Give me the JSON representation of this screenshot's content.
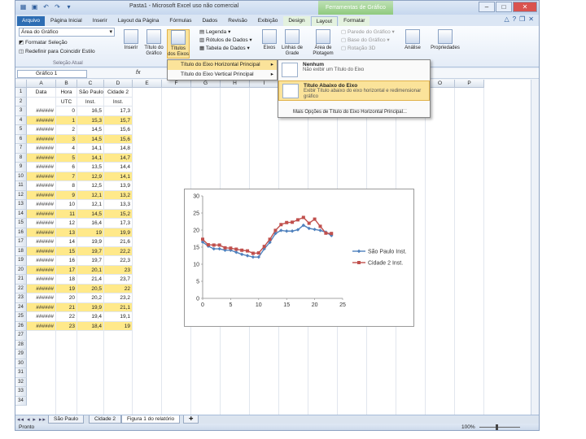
{
  "window": {
    "title": "Pasta1 - Microsoft Excel uso não comercial",
    "context_tab": "Ferramentas de Gráfico"
  },
  "tabs": [
    "Arquivo",
    "Página Inicial",
    "Inserir",
    "Layout da Página",
    "Fórmulas",
    "Dados",
    "Revisão",
    "Exibição",
    "Design",
    "Layout",
    "Formatar"
  ],
  "ribbon": {
    "combo_value": "Área do Gráfico",
    "format_selection": "Formatar Seleção",
    "reset_style": "Redefinir para Coincidir Estilo",
    "group_selection": "Seleção Atual",
    "insert": "Inserir",
    "chart_title": "Título do Gráfico",
    "axis_titles": "Títulos dos Eixos",
    "legend": "Legenda",
    "data_labels": "Rótulos de Dados",
    "data_table": "Tabela de Dados",
    "axes": "Eixos",
    "gridlines": "Linhas de Grade",
    "plot_area": "Área de Plotagem",
    "chart_wall": "Parede do Gráfico",
    "chart_floor": "Base do Gráfico",
    "rotation_3d": "Rotação 3D",
    "analysis": "Análise",
    "properties": "Propriedades"
  },
  "formula_bar": {
    "name_box": "Gráfico 1",
    "fx": "fx"
  },
  "menu1": {
    "items": [
      "Título do Eixo Horizontal Principal",
      "Título do Eixo Vertical Principal"
    ]
  },
  "menu2": {
    "none_title": "Nenhum",
    "none_desc": "Não exibir um Título do Eixo",
    "below_title": "Título Abaixo do Eixo",
    "below_desc": "Exibir Título abaixo do eixo horizontal e redimensionar gráfico",
    "more": "Mais Opções de Título do Eixo Horizontal Principal..."
  },
  "columns": [
    "A",
    "B",
    "C",
    "D",
    "E",
    "F",
    "G",
    "H",
    "I",
    "J",
    "K",
    "L",
    "M",
    "N",
    "O",
    "P"
  ],
  "header_row": {
    "a": "Data",
    "b": "Hora",
    "c": "São Paulo",
    "d": "Cidade 2"
  },
  "header_row2": {
    "b": "UTC",
    "c": "Inst.",
    "d": "Inst."
  },
  "rows": [
    {
      "b": "0",
      "c": "16,5",
      "d": "17,3"
    },
    {
      "b": "1",
      "c": "15,3",
      "d": "15,7"
    },
    {
      "b": "2",
      "c": "14,5",
      "d": "15,6"
    },
    {
      "b": "3",
      "c": "14,5",
      "d": "15,6"
    },
    {
      "b": "4",
      "c": "14,1",
      "d": "14,8"
    },
    {
      "b": "5",
      "c": "14,1",
      "d": "14,7"
    },
    {
      "b": "6",
      "c": "13,5",
      "d": "14,4"
    },
    {
      "b": "7",
      "c": "12,9",
      "d": "14,1"
    },
    {
      "b": "8",
      "c": "12,5",
      "d": "13,9"
    },
    {
      "b": "9",
      "c": "12,1",
      "d": "13,2"
    },
    {
      "b": "10",
      "c": "12,1",
      "d": "13,3"
    },
    {
      "b": "11",
      "c": "14,5",
      "d": "15,2"
    },
    {
      "b": "12",
      "c": "16,4",
      "d": "17,3"
    },
    {
      "b": "13",
      "c": "19",
      "d": "19,9"
    },
    {
      "b": "14",
      "c": "19,9",
      "d": "21,6"
    },
    {
      "b": "15",
      "c": "19,7",
      "d": "22,2"
    },
    {
      "b": "16",
      "c": "19,7",
      "d": "22,3"
    },
    {
      "b": "17",
      "c": "20,1",
      "d": "23"
    },
    {
      "b": "18",
      "c": "21,4",
      "d": "23,7"
    },
    {
      "b": "19",
      "c": "20,5",
      "d": "22"
    },
    {
      "b": "20",
      "c": "20,2",
      "d": "23,2"
    },
    {
      "b": "21",
      "c": "19,9",
      "d": "21,1"
    },
    {
      "b": "22",
      "c": "19,4",
      "d": "19,1"
    },
    {
      "b": "23",
      "c": "18,4",
      "d": "19"
    }
  ],
  "date_placeholder": "######",
  "row_numbers": [
    "1",
    "2",
    "3",
    "4",
    "5",
    "6",
    "7",
    "8",
    "9",
    "10",
    "11",
    "12",
    "13",
    "14",
    "15",
    "16",
    "17",
    "18",
    "19",
    "20",
    "21",
    "22",
    "23",
    "24",
    "25",
    "26",
    "27",
    "28",
    "29",
    "30",
    "31",
    "32",
    "33",
    "34"
  ],
  "sheets": [
    "São Paulo",
    "Cidade 2",
    "Figura 1 do relatório"
  ],
  "status": {
    "left": "Pronto",
    "zoom": "100%"
  },
  "colors": {
    "series1": "#4f81bd",
    "series2": "#c0504d",
    "highlight": "#ffe98a"
  },
  "chart_data": {
    "type": "line",
    "x": [
      0,
      1,
      2,
      3,
      4,
      5,
      6,
      7,
      8,
      9,
      10,
      11,
      12,
      13,
      14,
      15,
      16,
      17,
      18,
      19,
      20,
      21,
      22,
      23
    ],
    "series": [
      {
        "name": "São Paulo Inst.",
        "values": [
          16.5,
          15.3,
          14.5,
          14.5,
          14.1,
          14.1,
          13.5,
          12.9,
          12.5,
          12.1,
          12.1,
          14.5,
          16.4,
          19,
          19.9,
          19.7,
          19.7,
          20.1,
          21.4,
          20.5,
          20.2,
          19.9,
          19.4,
          18.4
        ]
      },
      {
        "name": "Cidade 2 Inst.",
        "values": [
          17.3,
          15.7,
          15.6,
          15.6,
          14.8,
          14.7,
          14.4,
          14.1,
          13.9,
          13.2,
          13.3,
          15.2,
          17.3,
          19.9,
          21.6,
          22.2,
          22.3,
          23,
          23.7,
          22,
          23.2,
          21.1,
          19.1,
          19
        ]
      }
    ],
    "xlim": [
      0,
      25
    ],
    "ylim": [
      0,
      30
    ],
    "xticks": [
      "0",
      "5",
      "10",
      "15",
      "20",
      "25"
    ],
    "yticks": [
      "0",
      "5",
      "10",
      "15",
      "20",
      "25",
      "30"
    ],
    "legend": "right",
    "grid": false
  }
}
